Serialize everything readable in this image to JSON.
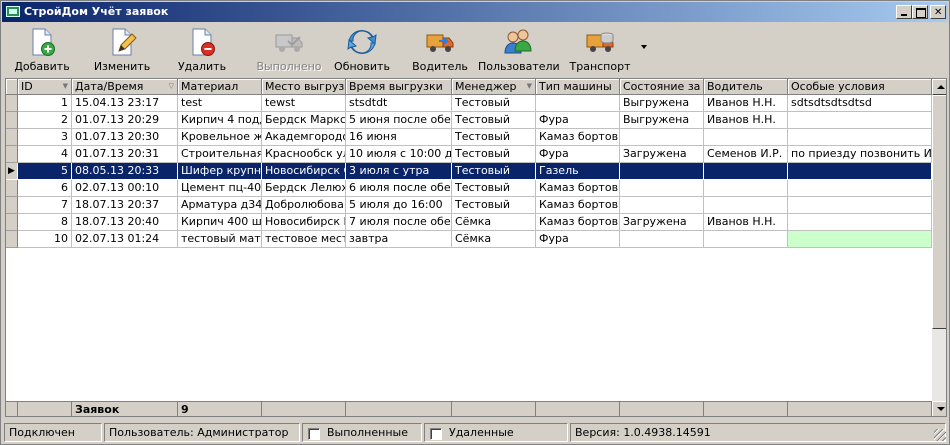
{
  "window": {
    "title": "СтройДом Учёт заявок"
  },
  "toolbar": {
    "buttons": [
      {
        "id": "add",
        "label": "Добавить",
        "icon": "document-add-icon",
        "enabled": true
      },
      {
        "id": "edit",
        "label": "Изменить",
        "icon": "document-edit-icon",
        "enabled": true
      },
      {
        "id": "delete",
        "label": "Удалить",
        "icon": "document-delete-icon",
        "enabled": true
      },
      {
        "id": "done",
        "label": "Выполнено",
        "icon": "truck-done-icon",
        "enabled": false
      },
      {
        "id": "refresh",
        "label": "Обновить",
        "icon": "refresh-icon",
        "enabled": true
      },
      {
        "id": "driver",
        "label": "Водитель",
        "icon": "driver-icon",
        "enabled": true
      },
      {
        "id": "users",
        "label": "Пользователи",
        "icon": "users-icon",
        "enabled": true
      },
      {
        "id": "transport",
        "label": "Транспорт",
        "icon": "transport-icon",
        "enabled": true
      }
    ]
  },
  "grid": {
    "columns": [
      "ID",
      "Дата/Время",
      "Материал",
      "Место выгрузки",
      "Время выгрузки",
      "Менеджер",
      "Тип машины",
      "Состояние за",
      "Водитель",
      "Особые условия"
    ],
    "rows": [
      [
        "1",
        "15.04.13 23:17",
        "test",
        "tewst",
        "stsdtdt",
        "Тестовый",
        "",
        "Выгружена",
        "Иванов Н.Н.",
        "sdtsdtsdtsdtsd"
      ],
      [
        "2",
        "01.07.13 20:29",
        "Кирпич 4 подд",
        "Бердск Маркса",
        "5 июня после обе",
        "Тестовый",
        "Фура",
        "Выгружена",
        "Иванов Н.Н.",
        ""
      ],
      [
        "3",
        "01.07.13 20:30",
        "Кровельное ж",
        "Академгородо",
        "16 июня",
        "Тестовый",
        "Камаз бортов",
        "",
        "",
        ""
      ],
      [
        "4",
        "01.07.13 20:31",
        "Строительная",
        "Краснообск ул",
        "10 июля с 10:00 д",
        "Тестовый",
        "Фура",
        "Загружена",
        "Семенов И.Р.",
        "по приезду позвонить Ив"
      ],
      [
        "5",
        "08.05.13 20:33",
        "Шифер крупно",
        "Новосибирск С",
        "3 июля с утра",
        "Тестовый",
        "Газель",
        "",
        "",
        ""
      ],
      [
        "6",
        "02.07.13 00:10",
        "Цемент пц-400",
        "Бердск Лелюх",
        "6 июля после обе",
        "Тестовый",
        "Камаз бортов",
        "",
        "",
        ""
      ],
      [
        "7",
        "18.07.13 20:37",
        "Арматура д34",
        "Добролюбова",
        "5 июля до 16:00",
        "Тестовый",
        "Камаз бортов",
        "",
        "",
        ""
      ],
      [
        "8",
        "18.07.13 20:40",
        "Кирпич 400 ш",
        "Новосибирск Р",
        "7 июля после обе",
        "Сёмка",
        "Камаз бортов",
        "Загружена",
        "Иванов Н.Н.",
        ""
      ],
      [
        "10",
        "02.07.13 01:24",
        "тестовый мате",
        "тестовое мест",
        "завтра",
        "Сёмка",
        "Фура",
        "",
        "",
        ""
      ]
    ],
    "selected_row_index": 4,
    "footer": {
      "label": "Заявок",
      "count": "9"
    }
  },
  "statusbar": {
    "connection": "Подключен",
    "user": "Пользователь: Администратор",
    "completed_label": "Выполненные",
    "deleted_label": "Удаленные",
    "version": "Версия: 1.0.4938.14591"
  }
}
